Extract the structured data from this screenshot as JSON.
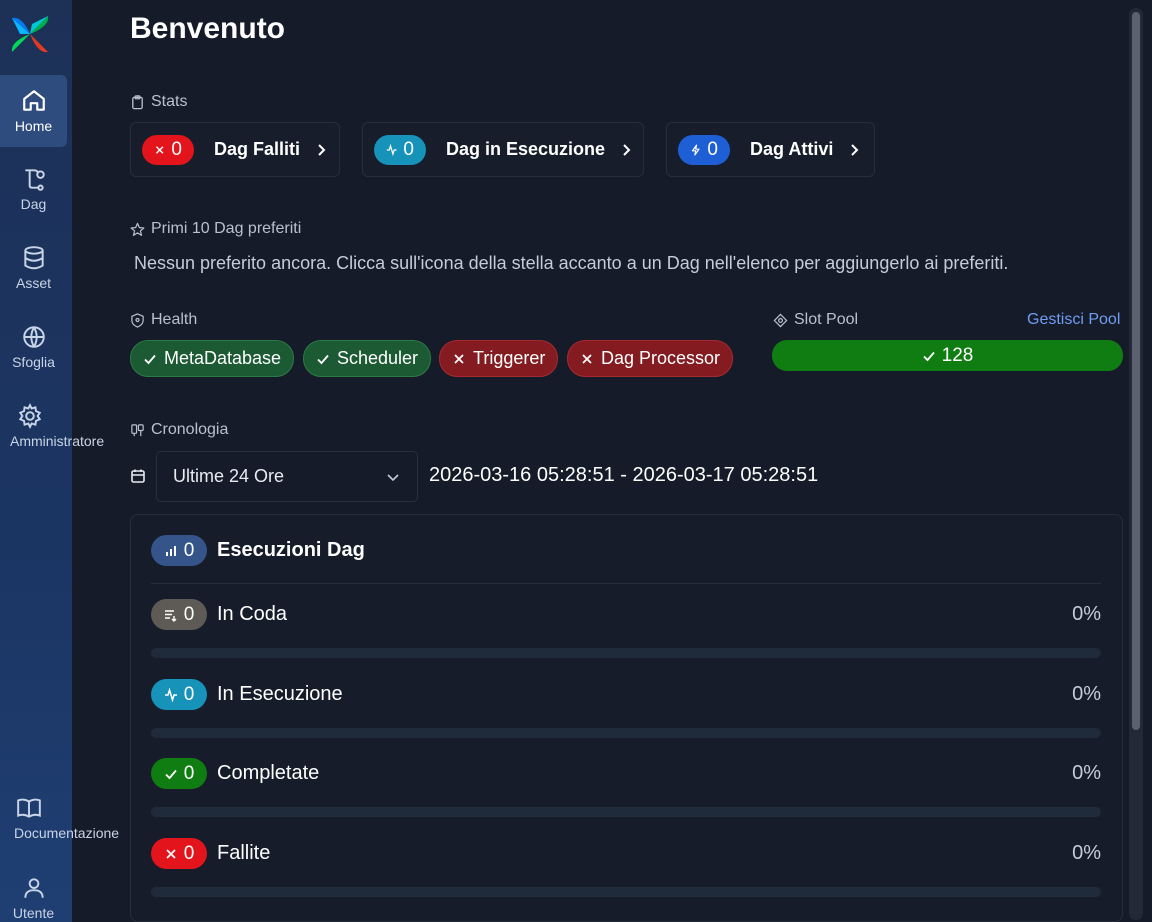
{
  "page": {
    "title": "Benvenuto"
  },
  "colors": {
    "accent": "#6f9df2",
    "failed": "#e3141b",
    "running": "#1792b8",
    "active": "#1f5fd6",
    "success": "#0f7d12",
    "queued": "#5e5a55",
    "total": "#35558a"
  },
  "sidebar": {
    "items": [
      {
        "label": "Home",
        "icon": "home-icon"
      },
      {
        "label": "Dag",
        "icon": "dag-icon"
      },
      {
        "label": "Asset",
        "icon": "database-icon"
      },
      {
        "label": "Sfoglia",
        "icon": "globe-icon"
      },
      {
        "label": "Amministratore",
        "icon": "gear-icon"
      },
      {
        "label": "Documentazione",
        "icon": "book-icon"
      },
      {
        "label": "Utente",
        "icon": "user-icon"
      }
    ]
  },
  "stats": {
    "label": "Stats",
    "cards": [
      {
        "count": "0",
        "name": "Dag Falliti",
        "icon": "x-icon"
      },
      {
        "count": "0",
        "name": "Dag in Esecuzione",
        "icon": "activity-icon"
      },
      {
        "count": "0",
        "name": "Dag Attivi",
        "icon": "bolt-icon"
      }
    ]
  },
  "favorites": {
    "label": "Primi 10 Dag preferiti",
    "empty": "Nessun preferito ancora. Clicca sull'icona della stella accanto a un Dag nell'elenco per aggiungerlo ai preferiti."
  },
  "health": {
    "label": "Health",
    "items": [
      {
        "name": "MetaDatabase",
        "status": "ok"
      },
      {
        "name": "Scheduler",
        "status": "ok"
      },
      {
        "name": "Triggerer",
        "status": "bad"
      },
      {
        "name": "Dag Processor",
        "status": "bad"
      }
    ]
  },
  "pool": {
    "label": "Slot Pool",
    "link": "Gestisci Pool",
    "value": "128",
    "fraction": 1.0
  },
  "history": {
    "label": "Cronologia",
    "select_value": "Ultime 24 Ore",
    "range": "2026-03-16 05:28:51 - 2026-03-17 05:28:51"
  },
  "runs": {
    "total_count": "0",
    "title": "Esecuzioni Dag",
    "rows": [
      {
        "count": "0",
        "label": "In Coda",
        "pct": "0%",
        "fraction": 0,
        "icon": "queue-icon"
      },
      {
        "count": "0",
        "label": "In Esecuzione",
        "pct": "0%",
        "fraction": 0,
        "icon": "activity-icon"
      },
      {
        "count": "0",
        "label": "Completate",
        "pct": "0%",
        "fraction": 0,
        "icon": "check-icon"
      },
      {
        "count": "0",
        "label": "Fallite",
        "pct": "0%",
        "fraction": 0,
        "icon": "x-icon"
      }
    ]
  }
}
